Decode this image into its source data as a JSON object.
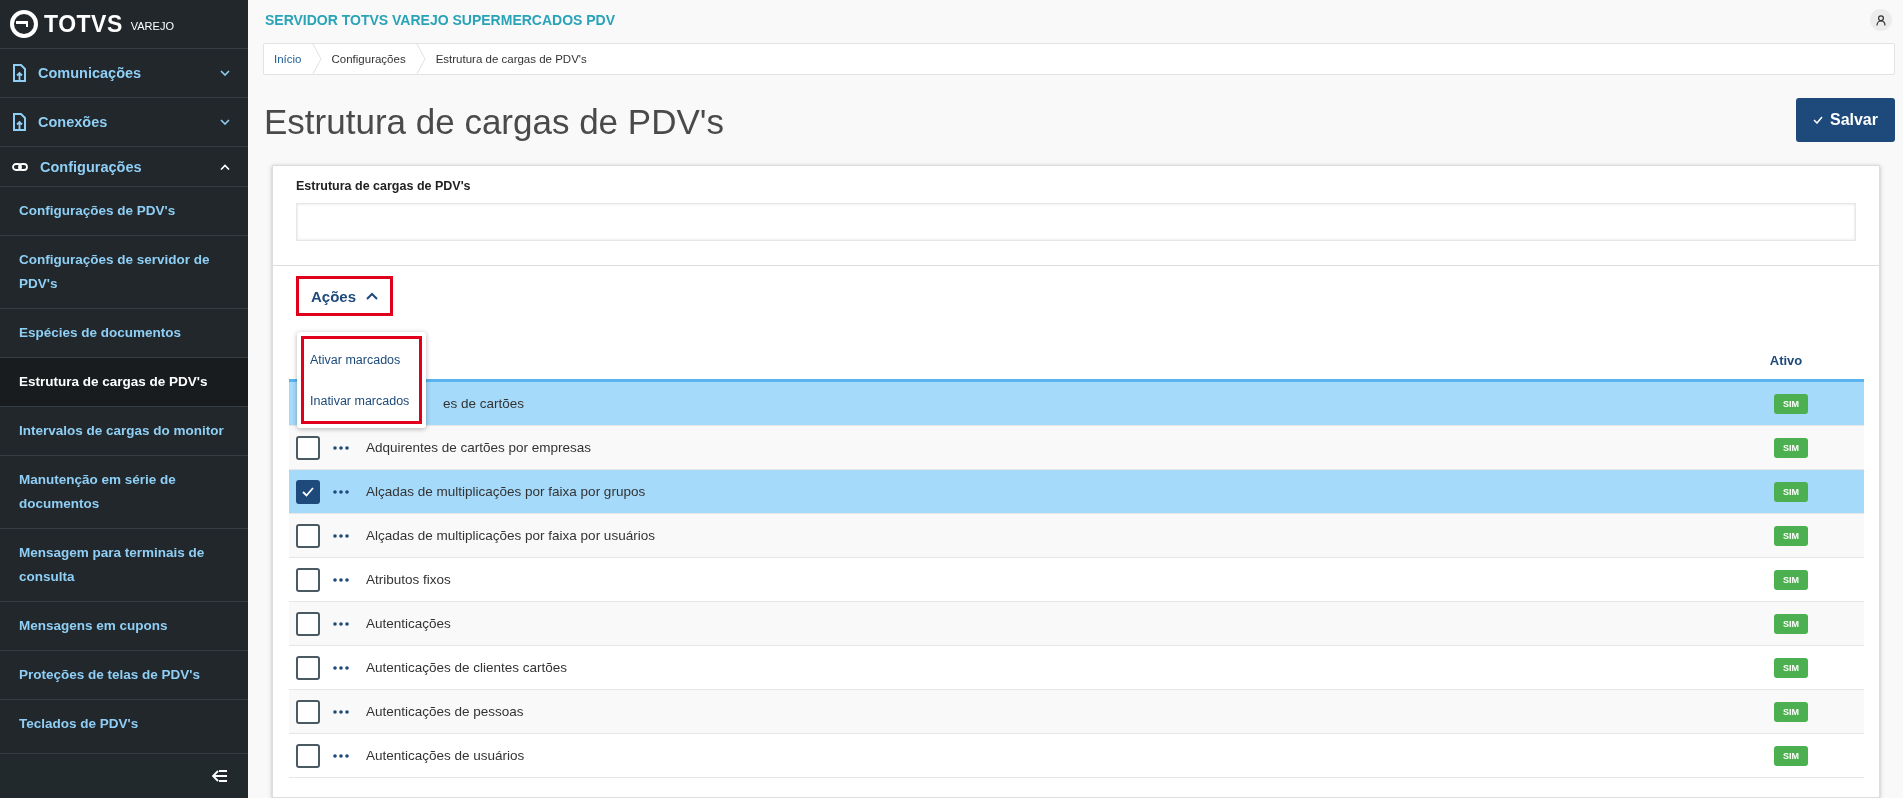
{
  "brand": {
    "name": "TOTVS",
    "suffix": "VAREJO"
  },
  "sidebar": {
    "groups": [
      {
        "label": "Comunicações",
        "kind": "upload",
        "expanded": false
      },
      {
        "label": "Conexões",
        "kind": "upload",
        "expanded": false
      },
      {
        "label": "Configurações",
        "kind": "link",
        "expanded": true,
        "children": [
          {
            "label": "Configurações de PDV's",
            "selected": false
          },
          {
            "label": "Configurações de servidor de PDV's",
            "selected": false
          },
          {
            "label": "Espécies de documentos",
            "selected": false
          },
          {
            "label": "Estrutura de cargas de PDV's",
            "selected": true
          },
          {
            "label": "Intervalos de cargas do monitor",
            "selected": false
          },
          {
            "label": "Manutenção em série de documentos",
            "selected": false
          },
          {
            "label": "Mensagem para terminais de consulta",
            "selected": false
          },
          {
            "label": "Mensagens em cupons",
            "selected": false
          },
          {
            "label": "Proteções de telas de PDV's",
            "selected": false
          },
          {
            "label": "Teclados de PDV's",
            "selected": false
          }
        ]
      }
    ]
  },
  "header": {
    "title": "SERVIDOR TOTVS VAREJO SUPERMERCADOS PDV"
  },
  "breadcrumb": [
    "Início",
    "Configurações",
    "Estrutura de cargas de PDV's"
  ],
  "page_title": "Estrutura de cargas de PDV's",
  "save_button": "Salvar",
  "form": {
    "label": "Estrutura de cargas de PDV's"
  },
  "actions": {
    "label": "Ações",
    "expanded": true,
    "annotated": true,
    "menu": {
      "annotated": true,
      "items": [
        "Ativar marcados",
        "Inativar marcados"
      ]
    }
  },
  "table": {
    "columns": [
      "Ativo"
    ],
    "rows": [
      {
        "kind": "covered",
        "name": "es de cartões",
        "selected": true,
        "status": "SIM"
      },
      {
        "kind": "normal",
        "name": "Adquirentes de cartões por empresas",
        "checked": false,
        "selected": false,
        "status": "SIM"
      },
      {
        "kind": "normal",
        "name": "Alçadas de multiplicações por faixa por grupos",
        "checked": true,
        "selected": true,
        "status": "SIM"
      },
      {
        "kind": "normal",
        "name": "Alçadas de multiplicações por faixa por usuários",
        "checked": false,
        "selected": false,
        "status": "SIM"
      },
      {
        "kind": "normal",
        "name": "Atributos fixos",
        "checked": false,
        "selected": false,
        "status": "SIM"
      },
      {
        "kind": "normal",
        "name": "Autenticações",
        "checked": false,
        "selected": false,
        "status": "SIM"
      },
      {
        "kind": "normal",
        "name": "Autenticações de clientes cartões",
        "checked": false,
        "selected": false,
        "status": "SIM"
      },
      {
        "kind": "normal",
        "name": "Autenticações de pessoas",
        "checked": false,
        "selected": false,
        "status": "SIM"
      },
      {
        "kind": "normal",
        "name": "Autenticações de usuários",
        "checked": false,
        "selected": false,
        "status": "SIM"
      }
    ]
  }
}
